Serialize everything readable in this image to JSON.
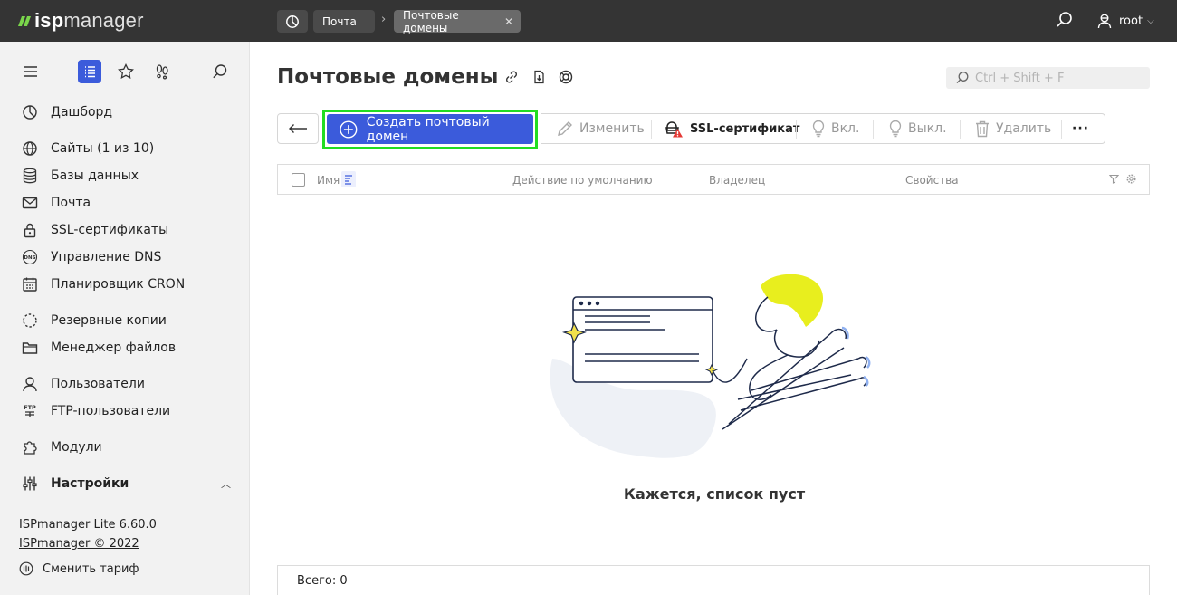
{
  "brand": {
    "logo_bold": "isp",
    "logo_rest": "manager"
  },
  "breadcrumbs": {
    "items": [
      {
        "label": "Почта"
      },
      {
        "label": "Почтовые домены"
      }
    ],
    "separator": "›",
    "close_glyph": "✕"
  },
  "user": {
    "name": "root"
  },
  "sidebar": {
    "tools": [
      "menu-icon",
      "list-icon",
      "star-icon",
      "footprints-icon",
      "search-icon"
    ],
    "items": [
      {
        "label": "Дашборд",
        "icon": "dashboard-icon"
      },
      {
        "label": "Сайты (1 из 10)",
        "icon": "globe-icon"
      },
      {
        "label": "Базы данных",
        "icon": "database-icon"
      },
      {
        "label": "Почта",
        "icon": "mail-icon"
      },
      {
        "label": "SSL-сертификаты",
        "icon": "lock-icon"
      },
      {
        "label": "Управление DNS",
        "icon": "dns-icon"
      },
      {
        "label": "Планировщик CRON",
        "icon": "calendar-icon"
      },
      {
        "label": "Резервные копии",
        "icon": "backup-icon"
      },
      {
        "label": "Менеджер файлов",
        "icon": "folder-icon"
      },
      {
        "label": "Пользователи",
        "icon": "user-icon"
      },
      {
        "label": "FTP-пользователи",
        "icon": "ftp-icon"
      },
      {
        "label": "Модули",
        "icon": "puzzle-icon"
      },
      {
        "label": "Настройки",
        "icon": "sliders-icon"
      }
    ],
    "version": "ISPmanager Lite 6.60.0",
    "copyright": "ISPmanager © 2022",
    "change_tariff": "Сменить тариф"
  },
  "page": {
    "title": "Почтовые домены",
    "filter_placeholder": "Ctrl + Shift + F"
  },
  "toolbar": {
    "create": "Создать почтовый домен",
    "edit": "Изменить",
    "ssl": "SSL-сертификат",
    "enable": "Вкл.",
    "disable": "Выкл.",
    "delete": "Удалить",
    "more": "···"
  },
  "table": {
    "columns": [
      "Имя",
      "Действие по умолчанию",
      "Владелец",
      "Свойства"
    ],
    "empty_message": "Кажется, список пуст",
    "total": "Всего: 0"
  },
  "colors": {
    "accent": "#3b5bdb",
    "highlight": "#22dd22",
    "topbar": "#343434",
    "logo_green": "#7ad64b"
  }
}
